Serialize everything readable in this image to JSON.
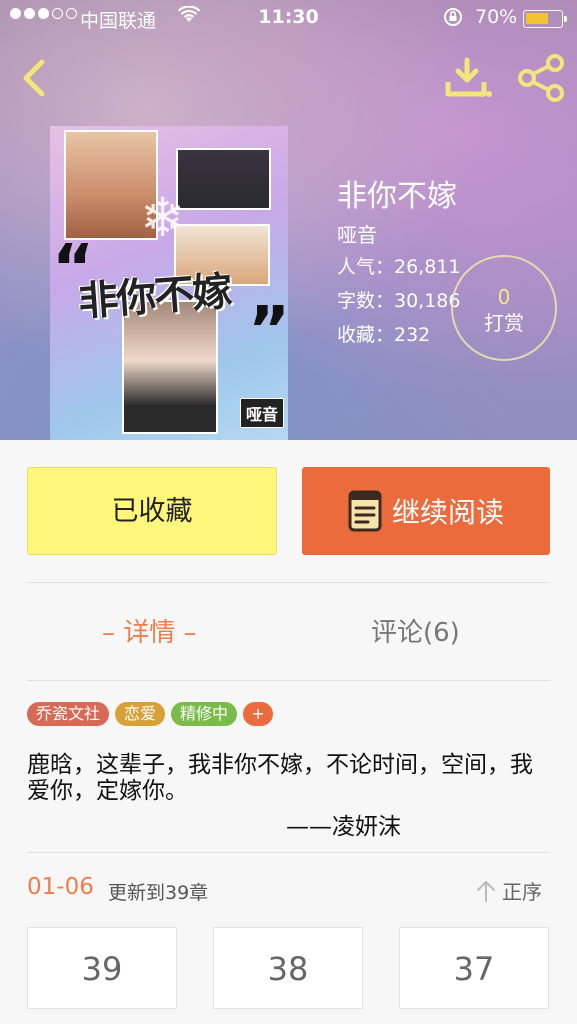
{
  "status_bar": {
    "carrier": "中国联通",
    "time": "11:30",
    "battery": "70%",
    "battery_level": 0.7
  },
  "book": {
    "title": "非你不嫁",
    "author": "哑音",
    "popularity": "人气：26,811",
    "word_count": "字数：30,186",
    "favorites": "收藏：232"
  },
  "cover": {
    "title_art": "非你不嫁",
    "author_tag": "哑音"
  },
  "reward": {
    "count": "0",
    "label": "打赏"
  },
  "actions": {
    "favorited_label": "已收藏",
    "continue_label": "继续阅读"
  },
  "tabs": {
    "detail": "– 详情 –",
    "comments": "评论(6)"
  },
  "tags": [
    {
      "label": "乔瓷文社",
      "color": "#d76a56"
    },
    {
      "label": "恋爱",
      "color": "#d8a138"
    },
    {
      "label": "精修中",
      "color": "#7bbb49"
    }
  ],
  "tag_add": "+",
  "description": "鹿晗，这辈子，我非你不嫁，不论时间，空间，我爱你，定嫁你。",
  "signature": "——凌妍沫",
  "update": {
    "date": "01-06",
    "text": "更新到39章",
    "sort_label": "正序"
  },
  "chapters": [
    "39",
    "38",
    "37"
  ],
  "colors": {
    "accent": "#ec6b3c",
    "favorite_bg": "#fff77c",
    "tab_active": "#ef7d4a"
  },
  "icons": [
    "back-icon",
    "download-icon",
    "share-icon",
    "book-icon",
    "sort-arrow-icon"
  ]
}
